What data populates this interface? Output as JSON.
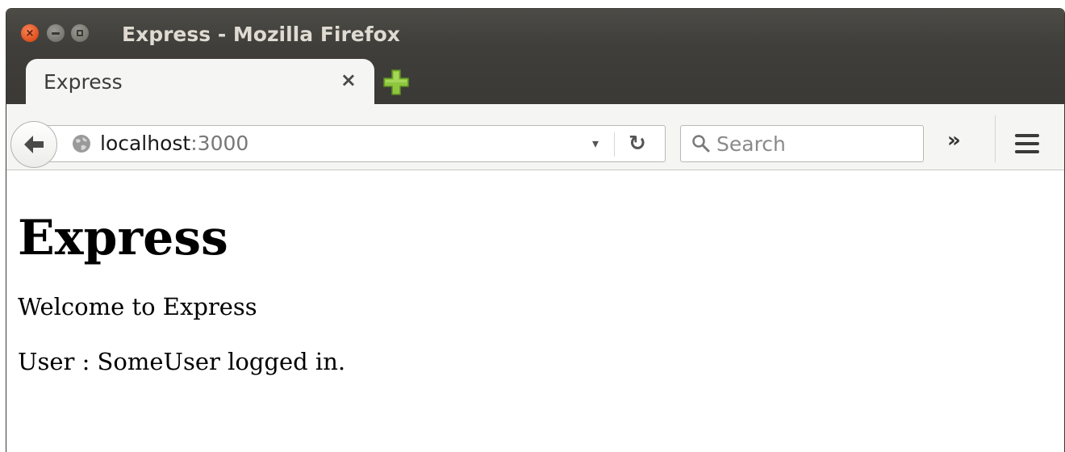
{
  "window": {
    "title": "Express - Mozilla Firefox"
  },
  "tab": {
    "label": "Express",
    "close_glyph": "×"
  },
  "navbar": {
    "url_host": "localhost",
    "url_port": ":3000",
    "dropdown_glyph": "▾",
    "reload_glyph": "↻",
    "search_placeholder": "Search",
    "overflow_glyph": "»"
  },
  "page": {
    "heading": "Express",
    "welcome": "Welcome to Express",
    "user_line": "User : SomeUser logged in."
  },
  "colors": {
    "titlebar": "#3f3e3a",
    "close_button": "#e0501c",
    "new_tab_plus": "#8ec73f",
    "toolbar": "#f5f5f4"
  },
  "icons": [
    "back-arrow-icon",
    "globe-icon",
    "reload-icon",
    "search-icon",
    "overflow-chevron-icon",
    "hamburger-menu-icon",
    "new-tab-plus-icon"
  ]
}
